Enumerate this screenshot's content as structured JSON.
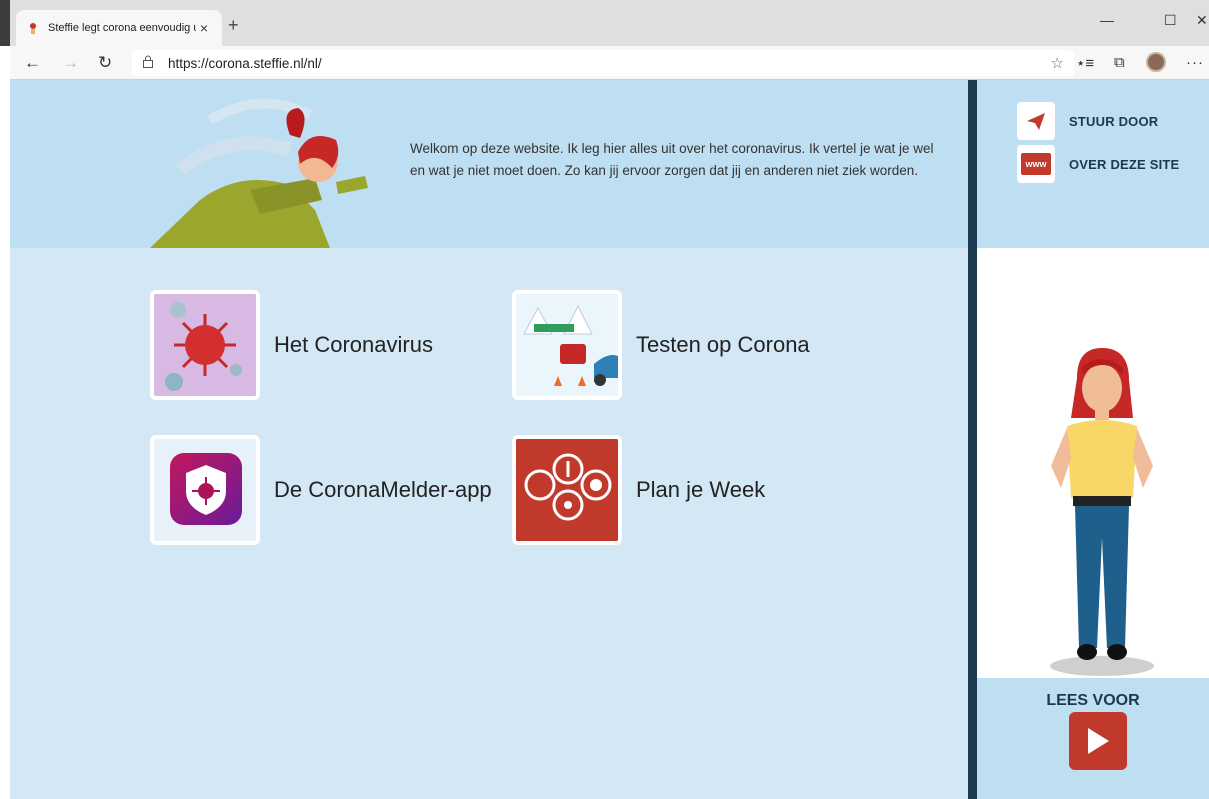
{
  "browser": {
    "tab_title": "Steffie legt corona eenvoudig uit",
    "tab_close": "×",
    "new_tab": "+",
    "url": "https://corona.steffie.nl/nl/",
    "window_controls": {
      "minimize": "—",
      "maximize": "☐",
      "close": "✕"
    },
    "nav": {
      "back": "←",
      "forward": "→",
      "refresh": "↻"
    },
    "tools": {
      "favorites": "☆",
      "reading_list": "⋆≡",
      "collections": "⧉",
      "more": "···"
    },
    "icons": [
      "steffie-favicon",
      "lock-icon",
      "star-icon",
      "favorites-icon",
      "collections-icon",
      "profile-avatar",
      "more-icon"
    ]
  },
  "hero": {
    "intro": "Welkom op deze website. Ik leg hier alles uit over het coronavirus. Ik vertel je wat je wel en wat je niet moet doen. Zo kan jij ervoor zorgen dat jij en anderen niet ziek worden."
  },
  "tiles": [
    {
      "label": "Het Coronavirus",
      "icon": "coronavirus-icon",
      "bg": "#d7b9e3"
    },
    {
      "label": "Testen op Corona",
      "icon": "test-tent-icon",
      "bg": "#eaf6fc"
    },
    {
      "label": "De CoronaMelder-app",
      "icon": "coronamelder-app-icon",
      "bg": "#e6f1fa"
    },
    {
      "label": "Plan je Week",
      "icon": "plan-week-icon",
      "bg": "#c0392b"
    }
  ],
  "sidebar": {
    "links": [
      {
        "label": "STUUR DOOR",
        "icon": "send-plane-icon"
      },
      {
        "label": "OVER DEZE SITE",
        "icon": "www-icon",
        "icon_text": "www"
      }
    ],
    "read_aloud": "LEES VOOR"
  },
  "colors": {
    "hero_bg": "#bedef2",
    "main_bg": "#d3e7f5",
    "divider": "#1c3a50",
    "accent_red": "#c0392b",
    "heading_navy": "#1b3a52"
  }
}
